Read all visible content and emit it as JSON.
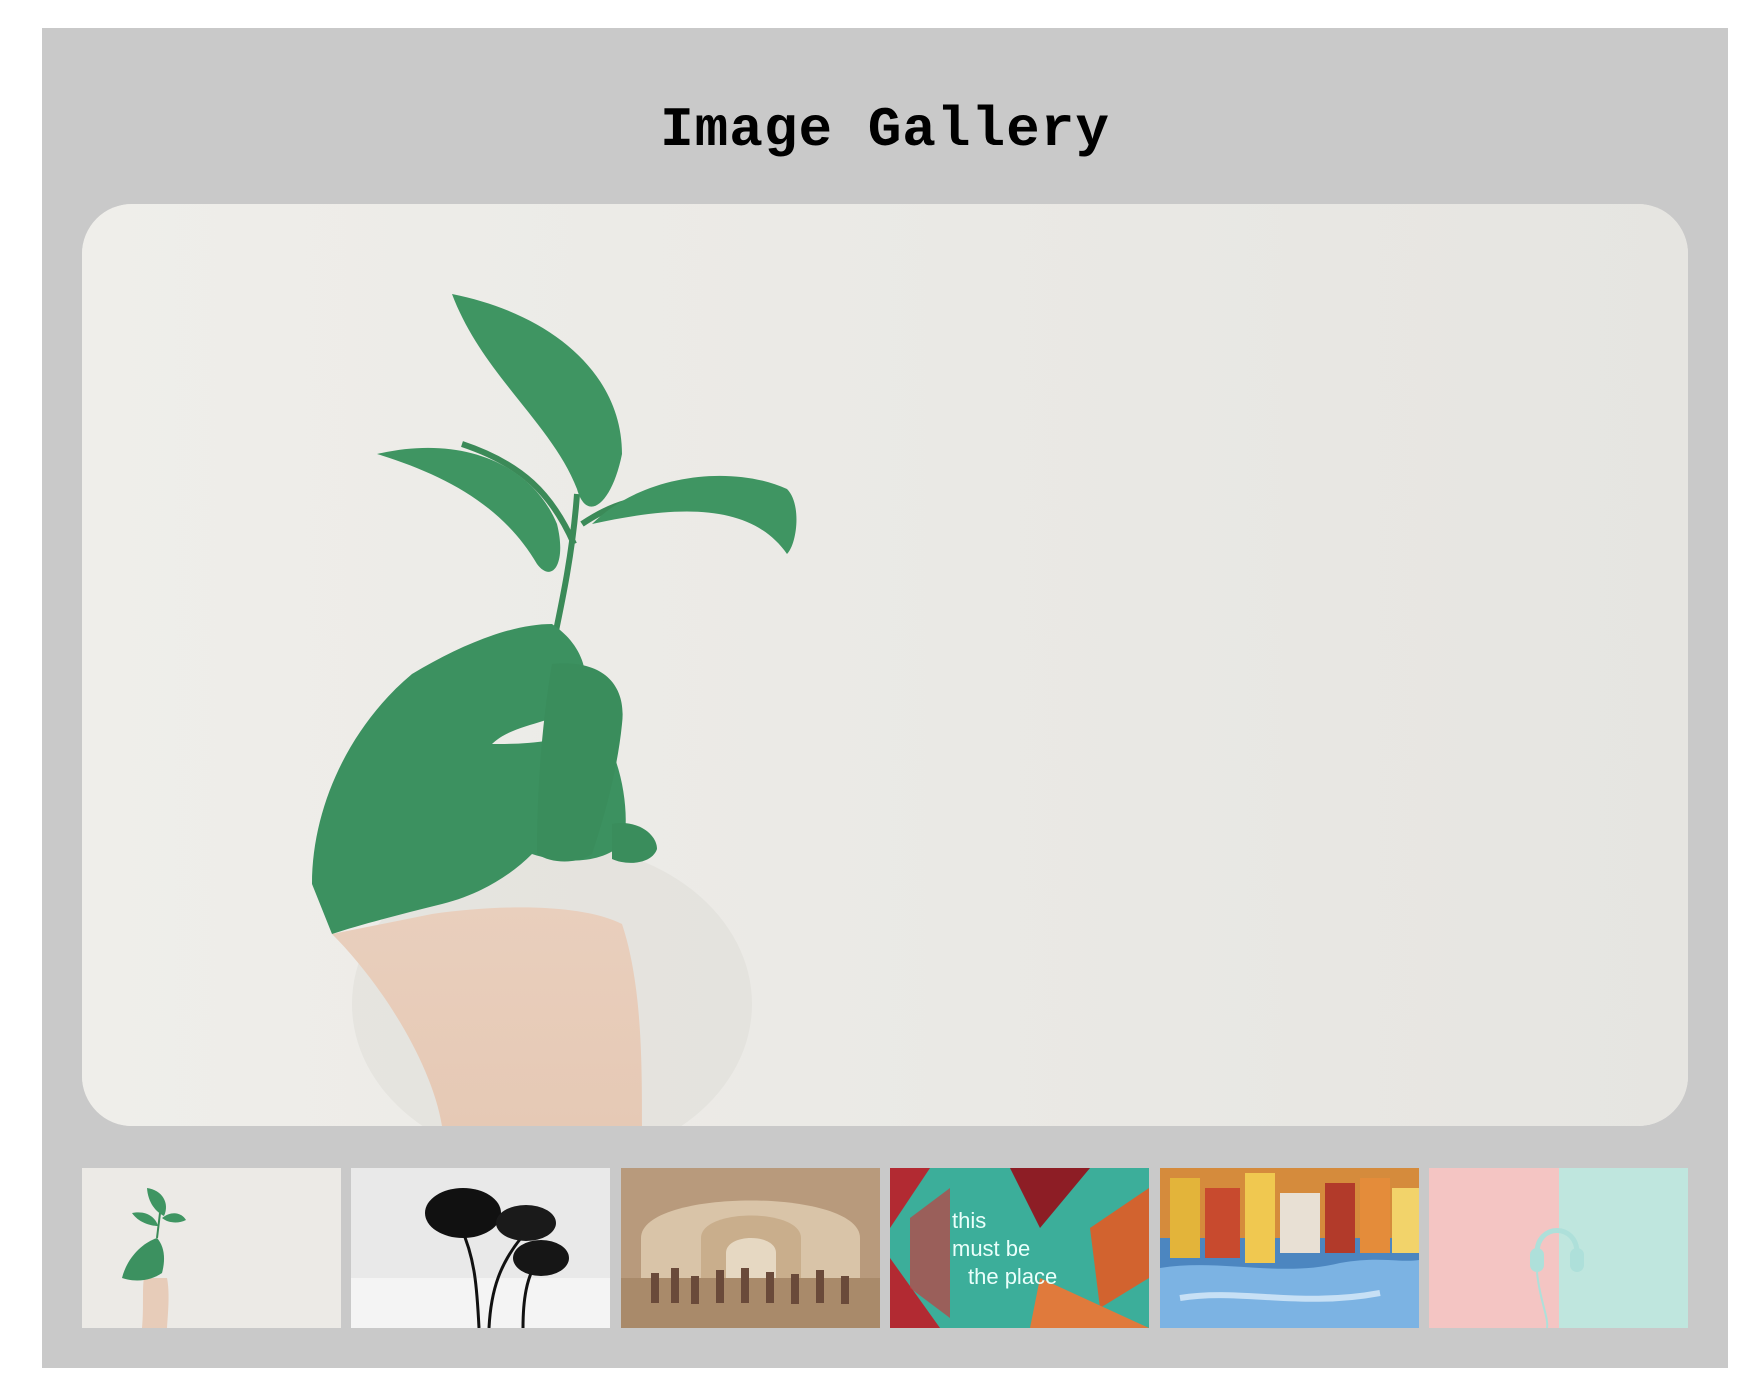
{
  "gallery": {
    "title": "Image Gallery",
    "background_color": "#c9c9c9"
  },
  "main_image": {
    "subject": "green-painted-hand-holding-plant"
  },
  "thumbnails": [
    {
      "subject": "green-painted-hand-holding-plant"
    },
    {
      "subject": "black-and-white-trees"
    },
    {
      "subject": "school-of-athens-fresco"
    },
    {
      "subject": "neon-sign-wall",
      "text_lines": [
        "this",
        "must be",
        "the place"
      ]
    },
    {
      "subject": "colorful-buildings-water-reflection"
    },
    {
      "subject": "pink-and-mint-headphones"
    }
  ]
}
